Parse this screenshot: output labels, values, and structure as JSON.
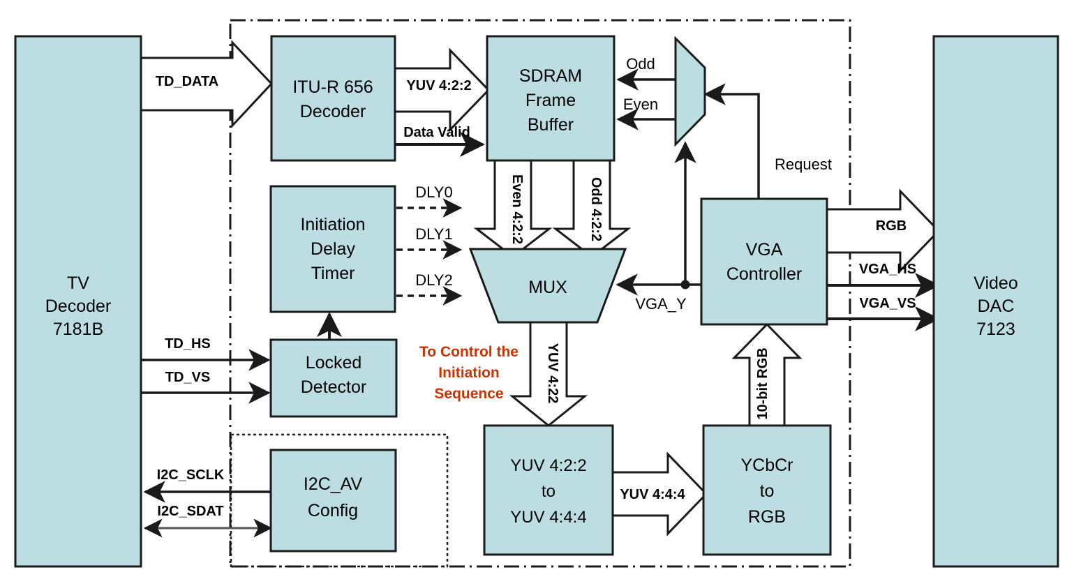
{
  "diagram": {
    "title": "TV Decoder to VGA Video Processing Block Diagram",
    "colors": {
      "block_fill": "#bcdee3",
      "block_stroke": "#1a1a1a",
      "note_color": "#cc3300",
      "wire": "#1a1a1a",
      "background": "#ffffff"
    },
    "external_blocks": [
      {
        "id": "tv_decoder",
        "line1": "TV",
        "line2": "Decoder",
        "line3": "7181B"
      },
      {
        "id": "video_dac",
        "line1": "Video",
        "line2": "DAC",
        "line3": "7123"
      }
    ],
    "blocks": [
      {
        "id": "itu_decoder",
        "line1": "ITU-R 656",
        "line2": "Decoder",
        "line3": ""
      },
      {
        "id": "sdram",
        "line1": "SDRAM",
        "line2": "Frame",
        "line3": "Buffer"
      },
      {
        "id": "init_timer",
        "line1": "Initiation",
        "line2": "Delay",
        "line3": "Timer"
      },
      {
        "id": "locked_detector",
        "line1": "Locked",
        "line2": "Detector",
        "line3": ""
      },
      {
        "id": "i2c_av_config",
        "line1": "I2C_AV",
        "line2": "Config",
        "line3": ""
      },
      {
        "id": "yuv422_to_444",
        "line1": "YUV 4:2:2",
        "line2": "to",
        "line3": "YUV 4:4:4"
      },
      {
        "id": "ycbcr_to_rgb",
        "line1": "YCbCr",
        "line2": "to",
        "line3": "RGB"
      },
      {
        "id": "vga_controller",
        "line1": "VGA",
        "line2": "Controller",
        "line3": ""
      }
    ],
    "mux_blocks": [
      {
        "id": "mux",
        "label": "MUX"
      },
      {
        "id": "odd_even_demux",
        "label": ""
      }
    ],
    "signals": {
      "td_data": "TD_DATA",
      "td_hs": "TD_HS",
      "td_vs": "TD_VS",
      "i2c_sclk": "I2C_SCLK",
      "i2c_sdat": "I2C_SDAT",
      "yuv422": "YUV 4:2:2",
      "data_valid": "Data Valid",
      "odd": "Odd",
      "even": "Even",
      "even_422": "Even 4:2:2",
      "odd_422": "Odd 4:2:2",
      "dly0": "DLY0",
      "dly1": "DLY1",
      "dly2": "DLY2",
      "yuv_422_out": "YUV 4:22",
      "vga_y": "VGA_Y",
      "request": "Request",
      "rgb": "RGB",
      "vga_hs": "VGA_HS",
      "vga_vs": "VGA_VS",
      "yuv444": "YUV 4:4:4",
      "rgb10": "10-bit RGB"
    },
    "annotations": {
      "init_note_line1": "To Control the",
      "init_note_line2": "Initiation",
      "init_note_line3": "Sequence"
    }
  }
}
